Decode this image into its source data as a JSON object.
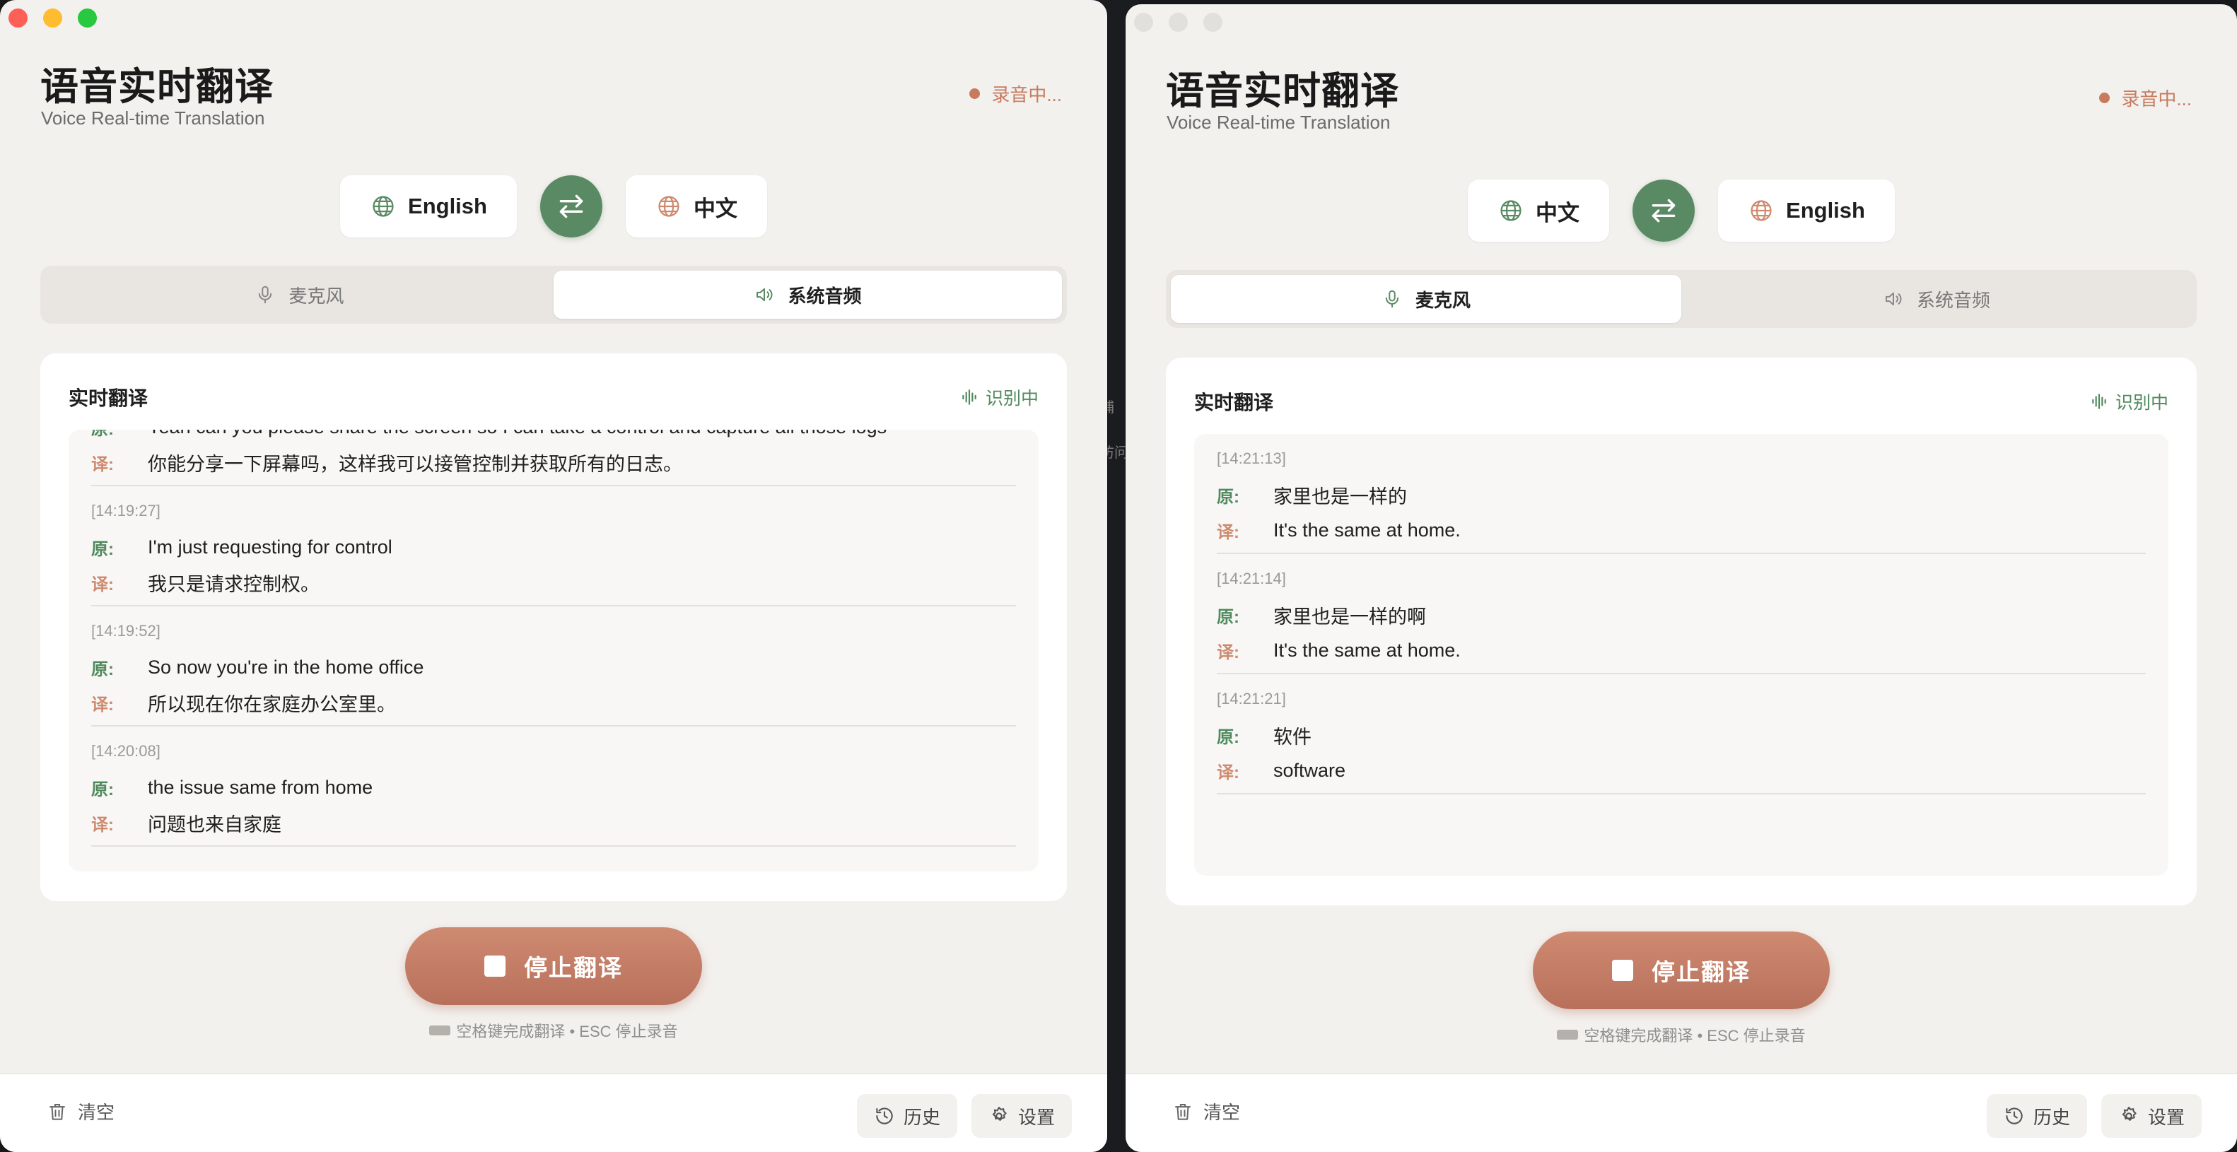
{
  "app": {
    "title": "语音实时翻译",
    "subtitle": "Voice Real-time Translation",
    "recording_label": "录音中...",
    "panel_title": "实时翻译",
    "recognizing_label": "识别中",
    "stop_label": "停止翻译",
    "hint": "空格键完成翻译 • ESC 停止录音",
    "source_tabs": {
      "mic": "麦克风",
      "system": "系统音频"
    },
    "footer": {
      "clear": "清空",
      "history": "历史",
      "settings": "设置"
    },
    "labels": {
      "original": "原:",
      "translated": "译:"
    }
  },
  "colors": {
    "accent_green": "#5a8a63",
    "accent_terracotta": "#c77a5e",
    "window_bg": "#f3f1ee"
  },
  "icons": {
    "globe": "globe-icon",
    "swap": "swap-arrows-icon",
    "mic": "microphone-icon",
    "speaker": "speaker-icon",
    "waveform": "waveform-icon",
    "trash": "trash-icon",
    "history": "history-icon",
    "gear": "gear-icon",
    "stop": "stop-icon",
    "keyboard": "keyboard-icon"
  },
  "left_window": {
    "source_lang": "English",
    "target_lang": "中文",
    "active_source": "系统音频",
    "entries": [
      {
        "time": "",
        "original": "Yeah can you please share the screen so I can take a control and capture all those logs",
        "translated": "你能分享一下屏幕吗，这样我可以接管控制并获取所有的日志。"
      },
      {
        "time": "[14:19:27]",
        "original": "I'm just requesting for control",
        "translated": "我只是请求控制权。"
      },
      {
        "time": "[14:19:52]",
        "original": "So now you're in the home office",
        "translated": "所以现在你在家庭办公室里。"
      },
      {
        "time": "[14:20:08]",
        "original": "the issue same from home",
        "translated": "问题也来自家庭"
      }
    ]
  },
  "right_window": {
    "source_lang": "中文",
    "target_lang": "English",
    "active_source": "麦克风",
    "entries": [
      {
        "time": "[14:21:13]",
        "original": "家里也是一样的",
        "translated": "It's the same at home."
      },
      {
        "time": "[14:21:14]",
        "original": "家里也是一样的啊",
        "translated": "It's the same at home."
      },
      {
        "time": "[14:21:21]",
        "original": "软件",
        "translated": "software"
      }
    ]
  },
  "background_fragments": [
    "捕",
    "访问"
  ]
}
